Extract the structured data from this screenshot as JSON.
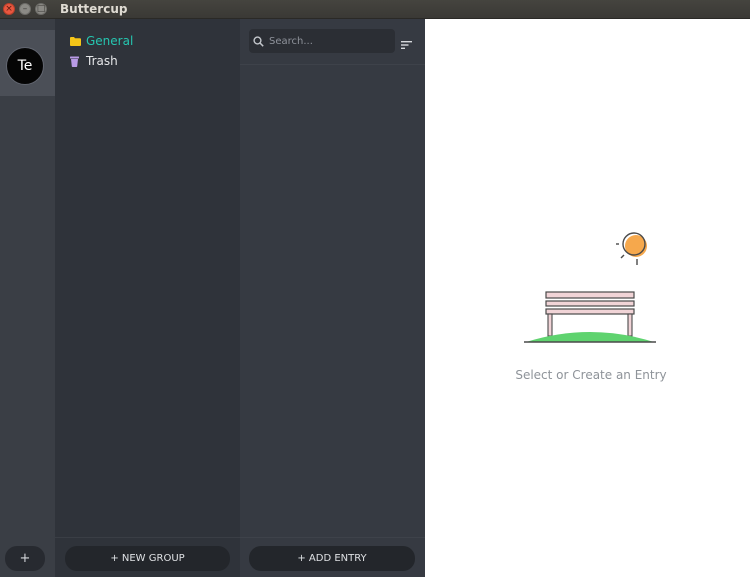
{
  "window": {
    "title": "Buttercup",
    "controls": [
      "close",
      "minimize",
      "maximize"
    ]
  },
  "vaults": {
    "items": [
      {
        "initials": "Te",
        "active": true
      }
    ],
    "add_label": "+"
  },
  "groups": {
    "items": [
      {
        "label": "General",
        "icon": "folder-icon",
        "active": true,
        "color": "#26c6b0"
      },
      {
        "label": "Trash",
        "icon": "trash-icon",
        "active": false
      }
    ],
    "new_group_label": "+ NEW GROUP"
  },
  "entries": {
    "search_placeholder": "Search...",
    "search_value": "",
    "add_entry_label": "+ ADD ENTRY",
    "items": []
  },
  "detail": {
    "empty_message": "Select or Create an Entry"
  },
  "colors": {
    "accent": "#26c6b0",
    "folder": "#f5c518",
    "trash": "#b99be6",
    "sun": "#f6a84c",
    "grass": "#5fd36f"
  }
}
